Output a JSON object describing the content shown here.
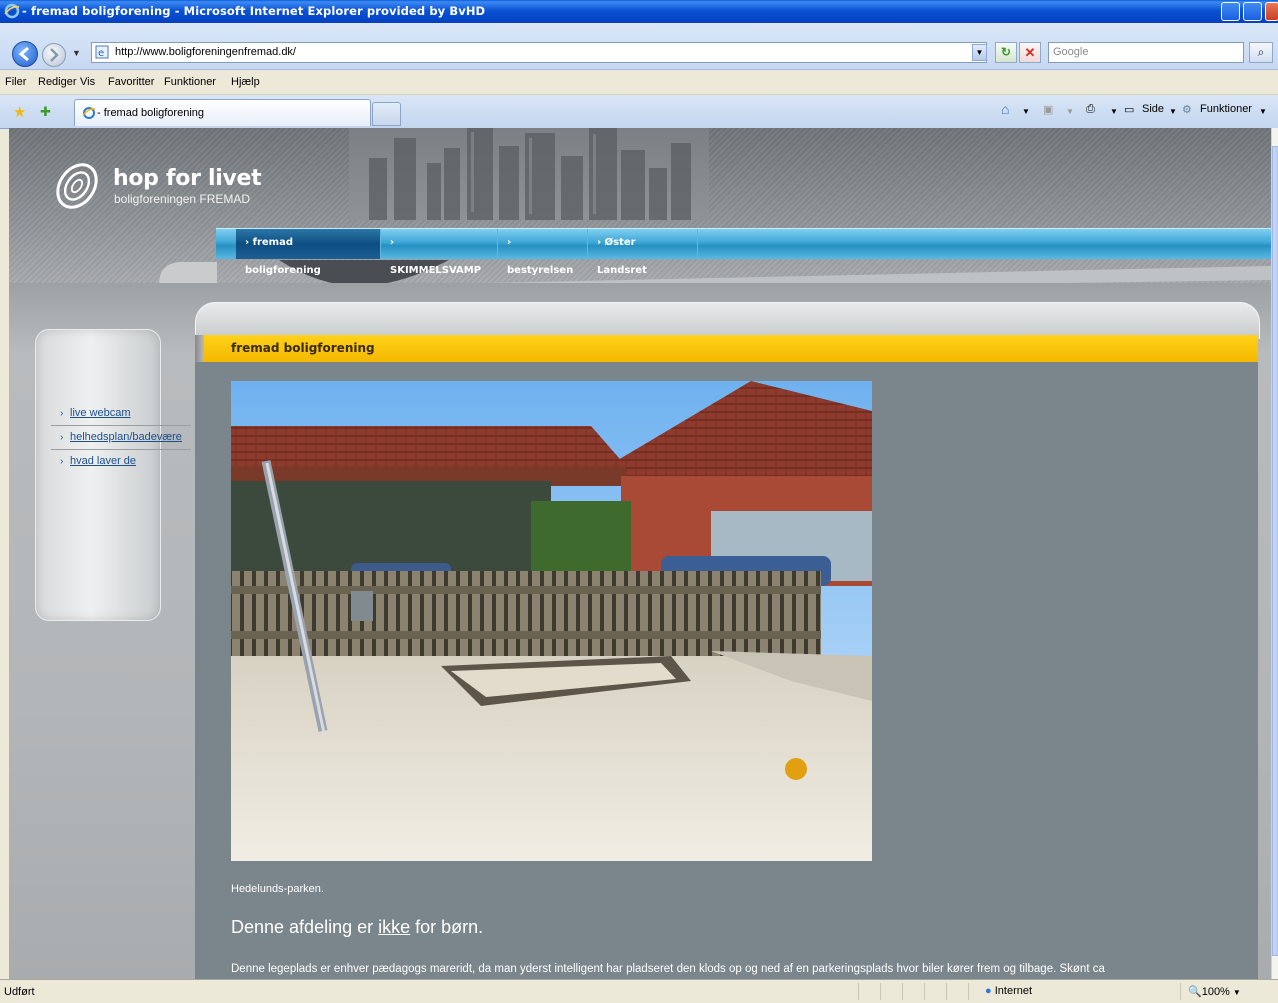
{
  "window": {
    "title": "- fremad boligforening - Microsoft Internet Explorer provided by BvHD"
  },
  "address_bar": {
    "url": "http://www.boligforeningenfremad.dk/",
    "search_placeholder": "Google"
  },
  "menu": {
    "items": [
      "Filer",
      "Rediger",
      "Vis",
      "Favoritter",
      "Funktioner",
      "Hjælp"
    ]
  },
  "tabs": {
    "active_tab_title": "- fremad boligforening"
  },
  "toolbar": {
    "page_label": "Side",
    "tools_label": "Funktioner"
  },
  "site": {
    "brand_title": "hop for livet",
    "brand_subtitle": "boligforeningen FREMAD",
    "nav": [
      {
        "label": "› fremad boligforening",
        "active": true
      },
      {
        "label": "› SKIMMELSVAMP",
        "active": false
      },
      {
        "label": "› bestyrelsen",
        "active": false
      },
      {
        "label": "› Øster Landsret",
        "active": false
      }
    ],
    "side_links": [
      "live webcam",
      "helhedsplan/badeværelse",
      "hvad laver de"
    ],
    "section_title": "fremad boligforening",
    "caption": "Hedelunds-parken.",
    "heading_before": "Denne afdeling er ",
    "heading_underlined": "ikke",
    "heading_after": " for børn.",
    "body_text": "Denne legeplads er enhver pædagogs mareridt, da man yderst intelligent har pladseret den klods op og ned af en parkeringsplads hvor biler kører frem og tilbage. Skønt ca"
  },
  "status": {
    "text": "Udført",
    "zone": "Internet",
    "zoom": "100%"
  },
  "colors": {
    "nav_bar": "#3ea6d6",
    "section_bar": "#ffcc00",
    "content_bg": "#7b868c"
  }
}
